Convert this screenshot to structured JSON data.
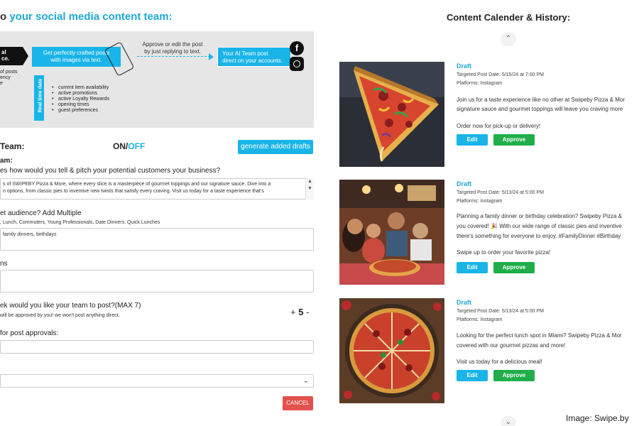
{
  "heading": {
    "prefix": "o ",
    "accent": "your social media content team:"
  },
  "diagram": {
    "black_arrow_text": "al\nce.",
    "left_small_text": "of posts\nency\ne",
    "box1_text": "Get perfectly crafted posts\nwith images via text.",
    "approve_text": "Approve or edit the post\nby just replying to text.",
    "box2_text": "Your AI Team post\ndirect on your accounts.",
    "facebook_glyph": "f",
    "realtime_label": "Real time data",
    "realtime_items": [
      "current item availability",
      "active promotions",
      "active Loyalty Rewards",
      "opening times",
      "guest preferences"
    ]
  },
  "team": {
    "label": "Team:",
    "on": "ON/",
    "off": "OFF",
    "generate_label": "generate added drafts"
  },
  "form": {
    "section_label": "am:",
    "q1_label": "es how would you tell & pitch your potential customers your business?",
    "q1_value": "s of SWIPEBY Pizza & More, where every slice is a masterpiece of gourmet toppings and our signature sauce. Dive into a\nn options, from classic pies to inventive new twists that satisfy every craving. Visit us today for a taste experience that's",
    "q2_label": "et audience? Add Multiple",
    "q2_hint": ", Lunch, Commuters, Young Professionals, Date Dinners, Quick Lunches",
    "q2_value": "family dinners, birthdays",
    "q3_label": "ns",
    "q4_label": "ek would you like your team to post?(MAX 7)",
    "q4_hint": "will be approved by you! we won't post anything direct.",
    "stepper": {
      "plus": "+",
      "value": "5",
      "minus": "-"
    },
    "q5_label": "for post approvals:",
    "cancel_label": "CANCEL"
  },
  "calendar": {
    "title": "Content Calender & History:",
    "chevron_up": "⌃",
    "chevron_down": "⌄",
    "posts": [
      {
        "status": "Draft",
        "date": "Targeted Post Date: 5/15/24 at 7:00 PM",
        "platform": "Platforms: Instagram",
        "line1": "Join us for a taste experience like no other at Swipeby Pizza & Mor",
        "line2": "signature sauce and gourmet toppings will leave you craving more",
        "line3": "",
        "cta": "Order now for pick-up or delivery!",
        "edit": "Edit",
        "approve": "Approve"
      },
      {
        "status": "Draft",
        "date": "Targeted Post Date: 5/13/24 at 5:00 PM",
        "platform": "Platforms: Instagram",
        "line1": "Planning a family dinner or birthday celebration? Swipeby Pizza &",
        "line2": "you covered! 🎉 With our wide range of classic pies and inventive",
        "line3": "there's something for everyone to enjoy. #FamilyDinner #Birthday",
        "cta": "Swipe up to order your favorite pizza!",
        "edit": "Edit",
        "approve": "Approve"
      },
      {
        "status": "Draft",
        "date": "Targeted Post Date: 5/13/24 at 5:00 PM",
        "platform": "Platforms: Instagram",
        "line1": "Looking for the perfect lunch spot in Miami? Swipeby Pizza & Mor",
        "line2": "covered with our gourmet pizzas and more!",
        "line3": "",
        "cta": "Visit us today for a delicious meal!",
        "edit": "Edit",
        "approve": "Approve"
      }
    ]
  },
  "watermark": "Image: Swipe.by",
  "colors": {
    "accent": "#19b4e8",
    "approve": "#1fae4a",
    "cancel": "#e2514d"
  }
}
